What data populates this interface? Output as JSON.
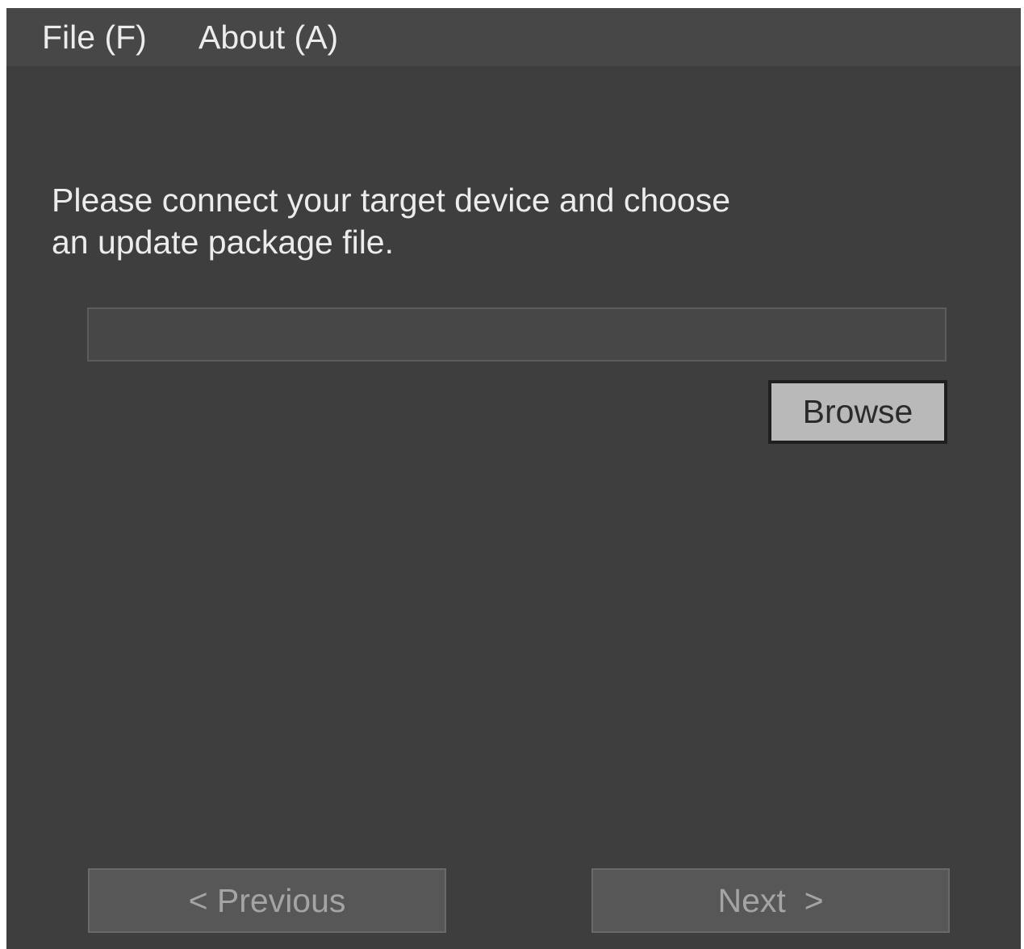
{
  "menubar": {
    "file_label": "File (F)",
    "about_label": "About (A)"
  },
  "main": {
    "instruction_line1": "Please connect your target device and choose",
    "instruction_line2": "an update package file.",
    "file_path_value": "",
    "browse_label": "Browse"
  },
  "footer": {
    "previous_label": "< Previous",
    "next_label": "Next  >"
  },
  "colors": {
    "background": "#3e3e3e",
    "menubar": "#474747",
    "text": "#ececec",
    "browse_button": "#b9b9b9",
    "disabled_button": "#575757"
  }
}
